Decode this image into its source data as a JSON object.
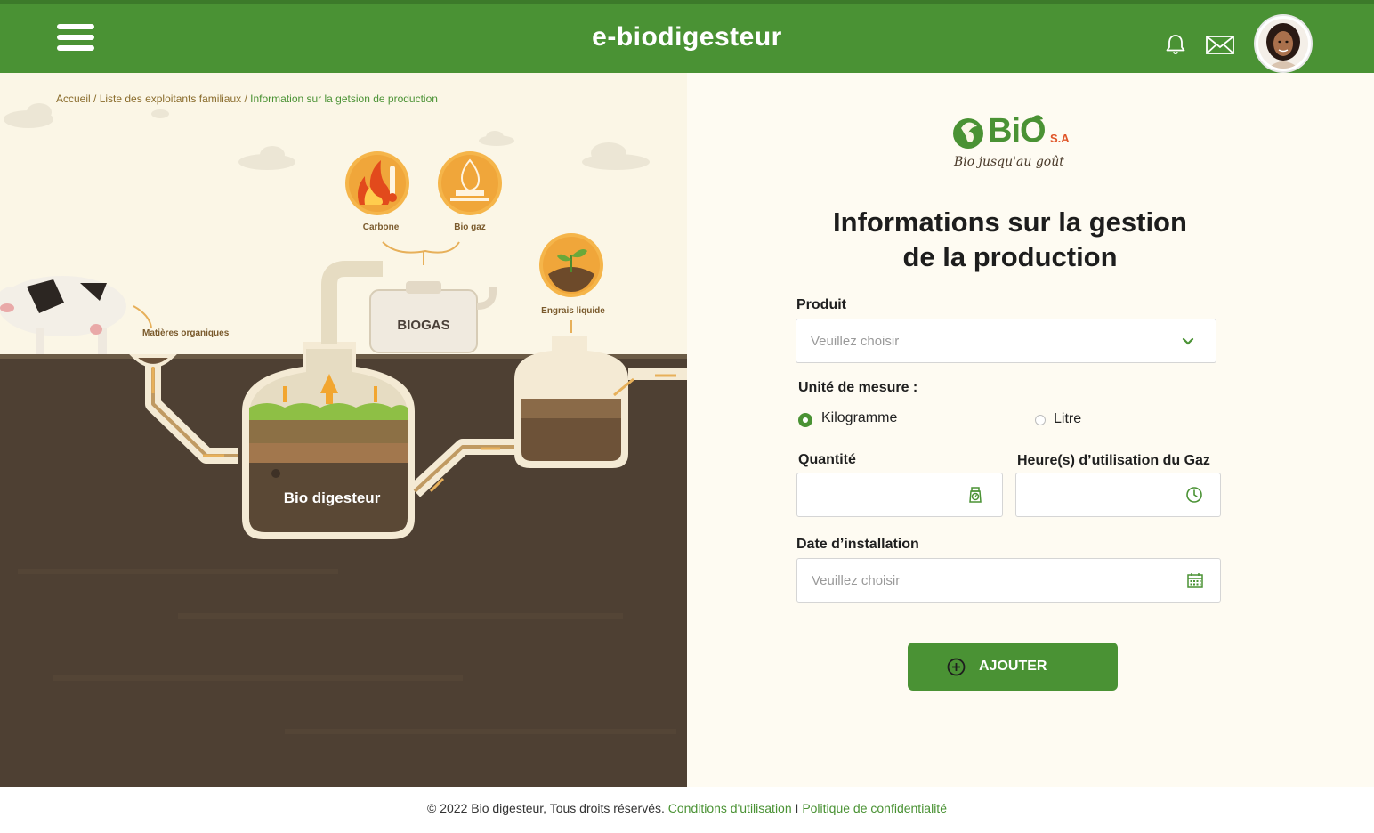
{
  "header": {
    "title": "e-biodigesteur",
    "menu_icon": "hamburger-menu-icon",
    "notification_icon": "bell-icon",
    "message_icon": "envelope-icon",
    "avatar_icon": "user-avatar"
  },
  "breadcrumb": {
    "items": [
      "Accueil",
      "Liste des exploitants familiaux"
    ],
    "current": "Information sur la getsion de production",
    "separator": " / "
  },
  "illustration": {
    "labels": {
      "carbone": "Carbone",
      "biogaz": "Bio gaz",
      "engrais": "Engrais liquide",
      "matieres": "Matières organiques",
      "biogas_tank": "BIOGAS",
      "digester": "Bio digesteur"
    }
  },
  "logo": {
    "brand": "BiO",
    "suffix": "S.A",
    "tagline": "Bio jusqu'au goût"
  },
  "form": {
    "title_line1": "Informations sur la gestion",
    "title_line2": "de la production",
    "produit": {
      "label": "Produit",
      "placeholder": "Veuillez choisir",
      "icon": "chevron-down-icon"
    },
    "unite": {
      "label": "Unité de mesure :",
      "options": [
        "Kilogramme",
        "Litre"
      ],
      "selected": "Kilogramme"
    },
    "quantite": {
      "label": "Quantité",
      "value": "",
      "icon": "scale-icon"
    },
    "heures": {
      "label": "Heure(s) d’utilisation du Gaz",
      "value": "",
      "icon": "clock-icon"
    },
    "date": {
      "label": "Date d’installation",
      "placeholder": "Veuillez choisir",
      "icon": "calendar-icon"
    },
    "submit_label": "AJOUTER",
    "submit_icon": "plus-circle-icon"
  },
  "footer": {
    "copyright": "© 2022 Bio digesteur, Tous droits réservés.",
    "terms": "Conditions d'utilisation",
    "separator": "I",
    "privacy": "Politique de confidentialité"
  },
  "colors": {
    "brand_green": "#4a9234",
    "soil": "#4e4033",
    "cream": "#fbf6e6",
    "accent_orange": "#f2a630"
  }
}
